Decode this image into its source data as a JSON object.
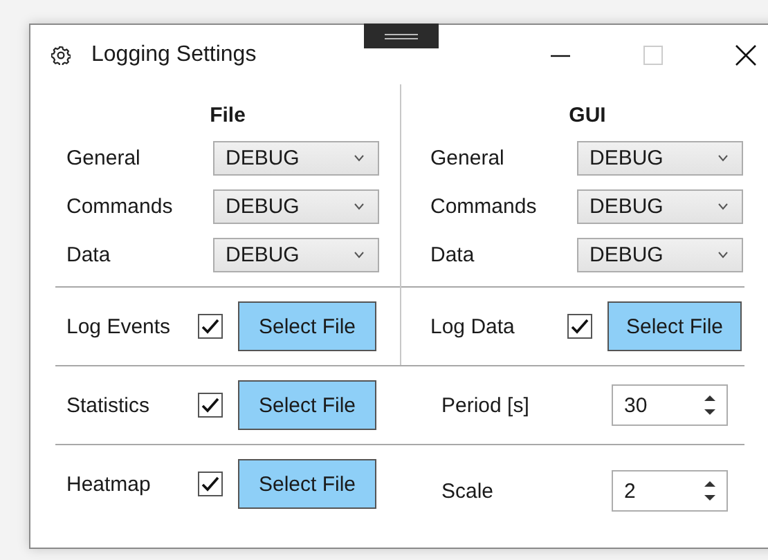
{
  "window": {
    "title": "Logging Settings"
  },
  "sections": [
    {
      "heading": "File",
      "levels": [
        {
          "label": "General",
          "value": "DEBUG"
        },
        {
          "label": "Commands",
          "value": "DEBUG"
        },
        {
          "label": "Data",
          "value": "DEBUG"
        }
      ],
      "log": {
        "label": "Log Events",
        "checked": true,
        "button": "Select File"
      }
    },
    {
      "heading": "GUI",
      "levels": [
        {
          "label": "General",
          "value": "DEBUG"
        },
        {
          "label": "Commands",
          "value": "DEBUG"
        },
        {
          "label": "Data",
          "value": "DEBUG"
        }
      ],
      "log": {
        "label": "Log Data",
        "checked": true,
        "button": "Select File"
      }
    }
  ],
  "options": [
    {
      "label": "Statistics",
      "checked": true,
      "button": "Select File",
      "field": {
        "label": "Period [s]",
        "value": "30"
      }
    },
    {
      "label": "Heatmap",
      "checked": true,
      "button": "Select File",
      "field": {
        "label": "Scale",
        "value": "2"
      }
    }
  ]
}
